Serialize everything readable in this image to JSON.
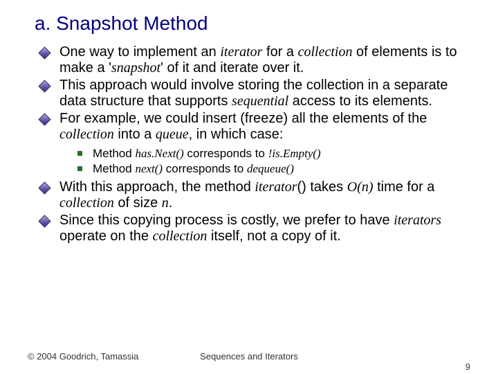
{
  "title": "a. Snapshot Method",
  "bullets": [
    {
      "pre": "One way to implement an ",
      "i1": "iterator",
      "mid1": " for a ",
      "i2": "collection",
      "mid2": " of elements is to make a '",
      "i3": "snapshot",
      "post": "' of it and iterate over it."
    },
    {
      "pre": "This approach would involve storing the collection in a separate data structure that supports ",
      "i1": "sequential",
      "post": " access to its elements."
    },
    {
      "pre": "For example, we could insert (freeze) all the elements of the ",
      "i1": "collection",
      "mid1": " into a ",
      "i2": "queue",
      "post": ", in which case:",
      "sub": [
        {
          "pre": "Method ",
          "i1": "has.Next()",
          "mid": " corresponds to ",
          "i2": "!is.Empty()"
        },
        {
          "pre": "Method ",
          "i1": "next()",
          "mid": " corresponds to ",
          "i2": "dequeue()"
        }
      ]
    },
    {
      "pre": "With this approach, the method ",
      "i1": "iterator",
      "mid1": "() takes ",
      "i2": "O(n)",
      "mid2": " time for a ",
      "i3": "collection",
      "mid3": " of size ",
      "i4": "n",
      "post": "."
    },
    {
      "pre": "Since this copying process is costly, we prefer to have ",
      "i1": "iterators",
      "mid1": " operate on the ",
      "i2": "collection",
      "post": " itself, not a copy of it."
    }
  ],
  "footer": {
    "left": "© 2004 Goodrich, Tamassia",
    "center": "Sequences and Iterators",
    "right": "9"
  }
}
